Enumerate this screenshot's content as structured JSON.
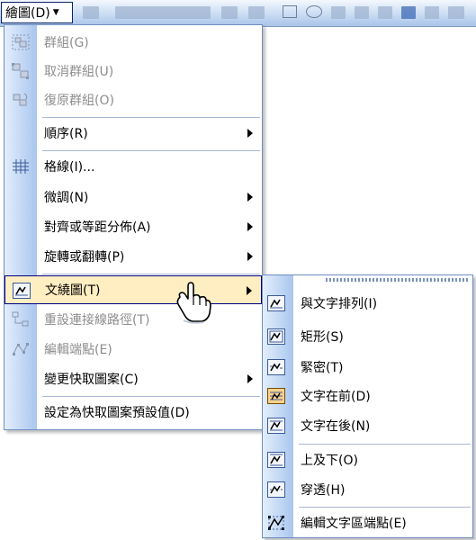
{
  "toolbar": {
    "draw_menu_label": "繪圖(D)"
  },
  "main_menu": {
    "items": [
      {
        "label": "群組(G)",
        "disabled": true,
        "icon": "group-icon"
      },
      {
        "label": "取消群組(U)",
        "disabled": true,
        "icon": "ungroup-icon"
      },
      {
        "label": "復原群組(O)",
        "disabled": true,
        "icon": "regroup-icon"
      },
      {
        "label": "順序(R)",
        "disabled": false,
        "has_submenu": true
      },
      {
        "label": "格線(I)...",
        "disabled": false,
        "icon": "grid-icon"
      },
      {
        "label": "微調(N)",
        "disabled": false,
        "has_submenu": true
      },
      {
        "label": "對齊或等距分佈(A)",
        "disabled": false,
        "has_submenu": true
      },
      {
        "label": "旋轉或翻轉(P)",
        "disabled": false,
        "has_submenu": true
      },
      {
        "label": "文繞圖(T)",
        "disabled": false,
        "has_submenu": true,
        "highlighted": true,
        "icon": "text-wrap-icon"
      },
      {
        "label": "重設連接線路徑(T)",
        "disabled": true,
        "icon": "reroute-connector-icon"
      },
      {
        "label": "編輯端點(E)",
        "disabled": true,
        "icon": "edit-points-icon"
      },
      {
        "label": "變更快取圖案(C)",
        "disabled": false,
        "has_submenu": true
      },
      {
        "label": "設定為快取圖案預設值(D)",
        "disabled": false
      }
    ]
  },
  "wrap_submenu": {
    "items": [
      {
        "label": "與文字排列(I)",
        "icon": "inline-with-text-icon"
      },
      {
        "label": "矩形(S)",
        "icon": "square-wrap-icon"
      },
      {
        "label": "緊密(T)",
        "icon": "tight-wrap-icon"
      },
      {
        "label": "文字在前(D)",
        "icon": "behind-text-icon",
        "selected": true
      },
      {
        "label": "文字在後(N)",
        "icon": "in-front-of-text-icon"
      },
      {
        "label": "上及下(O)",
        "icon": "top-and-bottom-icon"
      },
      {
        "label": "穿透(H)",
        "icon": "through-wrap-icon"
      },
      {
        "label": "編輯文字區端點(E)",
        "icon": "edit-wrap-points-icon"
      }
    ]
  },
  "colors": {
    "highlight_bg": "#ffeec2",
    "highlight_border": "#000080",
    "gutter_start": "#e3eefc",
    "gutter_end": "#a9c6ee",
    "disabled_text": "#8d8d8d"
  }
}
